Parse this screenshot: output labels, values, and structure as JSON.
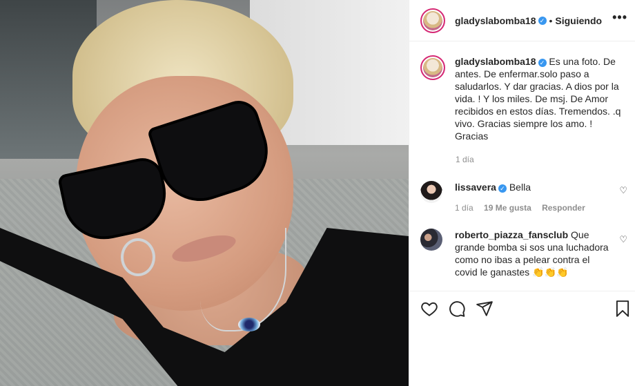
{
  "post": {
    "username": "gladyslabomba18",
    "follow_status": "Siguiendo",
    "more_label": "•••",
    "caption": "Es una foto. De antes. De enfermar.solo paso a saludarlos. Y dar gracias. A dios por la vida. ! Y los miles. De msj. De Amor recibidos en estos días. Tremendos. .q vivo. Gracias siempre los amo. ! Gracias",
    "caption_time": "1 día"
  },
  "comments": [
    {
      "username": "lissavera",
      "verified": true,
      "text": "Bella",
      "time": "1 día",
      "likes": "19 Me gusta",
      "reply": "Responder"
    },
    {
      "username": "roberto_piazza_fansclub",
      "verified": false,
      "text": "Que grande bomba si sos una luchadora como no ibas a pelear contra el covid le ganastes",
      "emoji": "👏👏👏"
    }
  ],
  "icons": {
    "verified": "verified-badge-icon",
    "more": "more-options-icon",
    "like": "heart-icon",
    "comment": "comment-icon",
    "share": "paper-plane-icon",
    "save": "bookmark-icon"
  },
  "colors": {
    "verified_blue": "#3897f0",
    "story_ring": "#d62976",
    "text": "#262626",
    "meta": "#8e8e8e"
  }
}
